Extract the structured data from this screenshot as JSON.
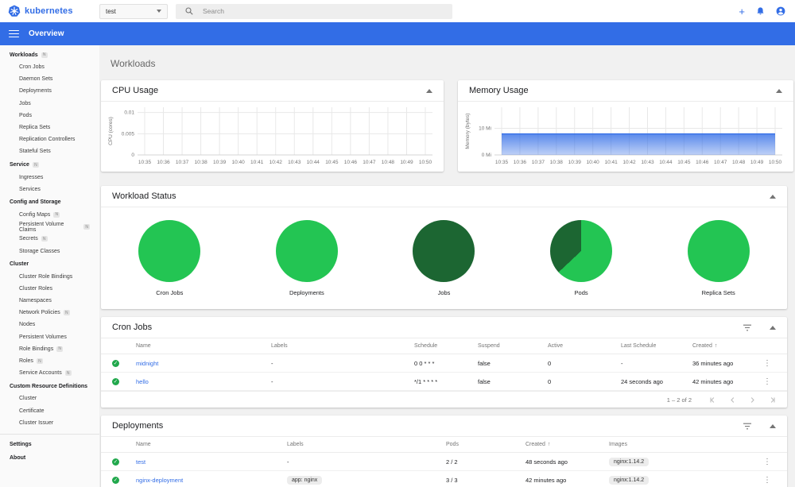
{
  "colors": {
    "accent": "#326de6",
    "status_ok": "#21a84c",
    "pie_green": "#23c553",
    "pie_dark_green": "#1c6632"
  },
  "header": {
    "brand": "kubernetes",
    "namespace_selector": {
      "value": "test"
    },
    "search": {
      "placeholder": "Search"
    }
  },
  "appbar": {
    "title": "Overview"
  },
  "page": {
    "title": "Workloads"
  },
  "sidebar": {
    "sections": [
      {
        "label": "Workloads",
        "badge": "N",
        "items": [
          {
            "label": "Cron Jobs"
          },
          {
            "label": "Daemon Sets"
          },
          {
            "label": "Deployments"
          },
          {
            "label": "Jobs"
          },
          {
            "label": "Pods"
          },
          {
            "label": "Replica Sets"
          },
          {
            "label": "Replication Controllers"
          },
          {
            "label": "Stateful Sets"
          }
        ]
      },
      {
        "label": "Service",
        "badge": "N",
        "items": [
          {
            "label": "Ingresses"
          },
          {
            "label": "Services"
          }
        ]
      },
      {
        "label": "Config and Storage",
        "items": [
          {
            "label": "Config Maps",
            "badge": "N"
          },
          {
            "label": "Persistent Volume Claims",
            "badge": "N"
          },
          {
            "label": "Secrets",
            "badge": "N"
          },
          {
            "label": "Storage Classes"
          }
        ]
      },
      {
        "label": "Cluster",
        "items": [
          {
            "label": "Cluster Role Bindings"
          },
          {
            "label": "Cluster Roles"
          },
          {
            "label": "Namespaces"
          },
          {
            "label": "Network Policies",
            "badge": "N"
          },
          {
            "label": "Nodes"
          },
          {
            "label": "Persistent Volumes"
          },
          {
            "label": "Role Bindings",
            "badge": "N"
          },
          {
            "label": "Roles",
            "badge": "N"
          },
          {
            "label": "Service Accounts",
            "badge": "N"
          }
        ]
      },
      {
        "label": "Custom Resource Definitions",
        "items": [
          {
            "label": "Cluster"
          },
          {
            "label": "Certificate"
          },
          {
            "label": "Cluster Issuer"
          }
        ]
      }
    ],
    "footer_items": [
      {
        "label": "Settings"
      },
      {
        "label": "About"
      }
    ]
  },
  "chart_data": [
    {
      "id": "cpu",
      "type": "line",
      "title": "CPU Usage",
      "ylabel": "CPU (cores)",
      "x": [
        "10:35",
        "10:36",
        "10:37",
        "10:38",
        "10:39",
        "10:40",
        "10:41",
        "10:42",
        "10:43",
        "10:44",
        "10:45",
        "10:46",
        "10:47",
        "10:48",
        "10:49",
        "10:50"
      ],
      "y_ticks": [
        {
          "value": 0,
          "label": "0"
        },
        {
          "value": 0.005,
          "label": "0.005"
        },
        {
          "value": 0.01,
          "label": "0.01"
        }
      ],
      "ylim": [
        0,
        0.01125
      ],
      "grid": true,
      "series": []
    },
    {
      "id": "memory",
      "type": "area",
      "title": "Memory Usage",
      "ylabel": "Memory (bytes)",
      "x": [
        "10:35",
        "10:36",
        "10:37",
        "10:38",
        "10:39",
        "10:40",
        "10:41",
        "10:42",
        "10:43",
        "10:44",
        "10:45",
        "10:46",
        "10:47",
        "10:48",
        "10:49",
        "10:50"
      ],
      "y_ticks": [
        {
          "value": 0,
          "label": "0 Mi"
        },
        {
          "value": 10,
          "label": "10 Mi"
        }
      ],
      "ylim": [
        0,
        17.9
      ],
      "grid": true,
      "series": [
        {
          "color": "#326de6",
          "values": [
            7.9,
            7.9,
            7.9,
            7.9,
            7.9,
            7.9,
            7.9,
            7.9,
            7.9,
            7.9,
            7.9,
            7.9,
            7.9,
            7.9,
            7.9,
            7.9
          ]
        }
      ]
    },
    {
      "id": "workload-status",
      "type": "pie",
      "title": "Workload Status",
      "pies": [
        {
          "label": "Cron Jobs",
          "slices": [
            {
              "fraction": 1,
              "color": "#23c553"
            }
          ]
        },
        {
          "label": "Deployments",
          "slices": [
            {
              "fraction": 1,
              "color": "#23c553"
            }
          ]
        },
        {
          "label": "Jobs",
          "slices": [
            {
              "fraction": 1,
              "color": "#1c6632"
            }
          ]
        },
        {
          "label": "Pods",
          "slices": [
            {
              "fraction": 0.63,
              "color": "#23c553"
            },
            {
              "fraction": 0.37,
              "color": "#1c6632"
            }
          ]
        },
        {
          "label": "Replica Sets",
          "slices": [
            {
              "fraction": 1,
              "color": "#23c553"
            }
          ]
        }
      ]
    }
  ],
  "tables": {
    "cron_jobs": {
      "title": "Cron Jobs",
      "columns": [
        {
          "label": ""
        },
        {
          "label": "Name"
        },
        {
          "label": "Labels"
        },
        {
          "label": "Schedule"
        },
        {
          "label": "Suspend"
        },
        {
          "label": "Active"
        },
        {
          "label": "Last Schedule"
        },
        {
          "label": "Created",
          "sort": "asc"
        },
        {
          "label": ""
        }
      ],
      "rows": [
        {
          "cells": [
            {
              "type": "status"
            },
            {
              "type": "link",
              "text": "midnight"
            },
            {
              "type": "text",
              "text": "-"
            },
            {
              "type": "text",
              "text": "0 0 * * *"
            },
            {
              "type": "text",
              "text": "false"
            },
            {
              "type": "text",
              "text": "0"
            },
            {
              "type": "underline",
              "text": "-"
            },
            {
              "type": "underline",
              "text": "36 minutes ago"
            },
            {
              "type": "menu"
            }
          ]
        },
        {
          "cells": [
            {
              "type": "status"
            },
            {
              "type": "link",
              "text": "hello"
            },
            {
              "type": "text",
              "text": "-"
            },
            {
              "type": "text",
              "text": "*/1 * * * *"
            },
            {
              "type": "text",
              "text": "false"
            },
            {
              "type": "text",
              "text": "0"
            },
            {
              "type": "underline",
              "text": "24 seconds ago"
            },
            {
              "type": "underline",
              "text": "42 minutes ago"
            },
            {
              "type": "menu"
            }
          ]
        }
      ],
      "pagination": {
        "range": "1 – 2 of 2"
      }
    },
    "deployments": {
      "title": "Deployments",
      "columns": [
        {
          "label": ""
        },
        {
          "label": "Name"
        },
        {
          "label": "Labels"
        },
        {
          "label": "Pods"
        },
        {
          "label": "Created",
          "sort": "asc"
        },
        {
          "label": "Images"
        },
        {
          "label": ""
        }
      ],
      "rows": [
        {
          "cells": [
            {
              "type": "status"
            },
            {
              "type": "link",
              "text": "test"
            },
            {
              "type": "text",
              "text": "-"
            },
            {
              "type": "text",
              "text": "2 / 2"
            },
            {
              "type": "underline",
              "text": "48 seconds ago"
            },
            {
              "type": "chip",
              "text": "nginx:1.14.2"
            },
            {
              "type": "menu"
            }
          ]
        },
        {
          "cells": [
            {
              "type": "status"
            },
            {
              "type": "link",
              "text": "nginx-deployment"
            },
            {
              "type": "chip",
              "text": "app: nginx"
            },
            {
              "type": "text",
              "text": "3 / 3"
            },
            {
              "type": "underline",
              "text": "42 minutes ago"
            },
            {
              "type": "chip",
              "text": "nginx:1.14.2"
            },
            {
              "type": "menu"
            }
          ]
        }
      ]
    }
  }
}
